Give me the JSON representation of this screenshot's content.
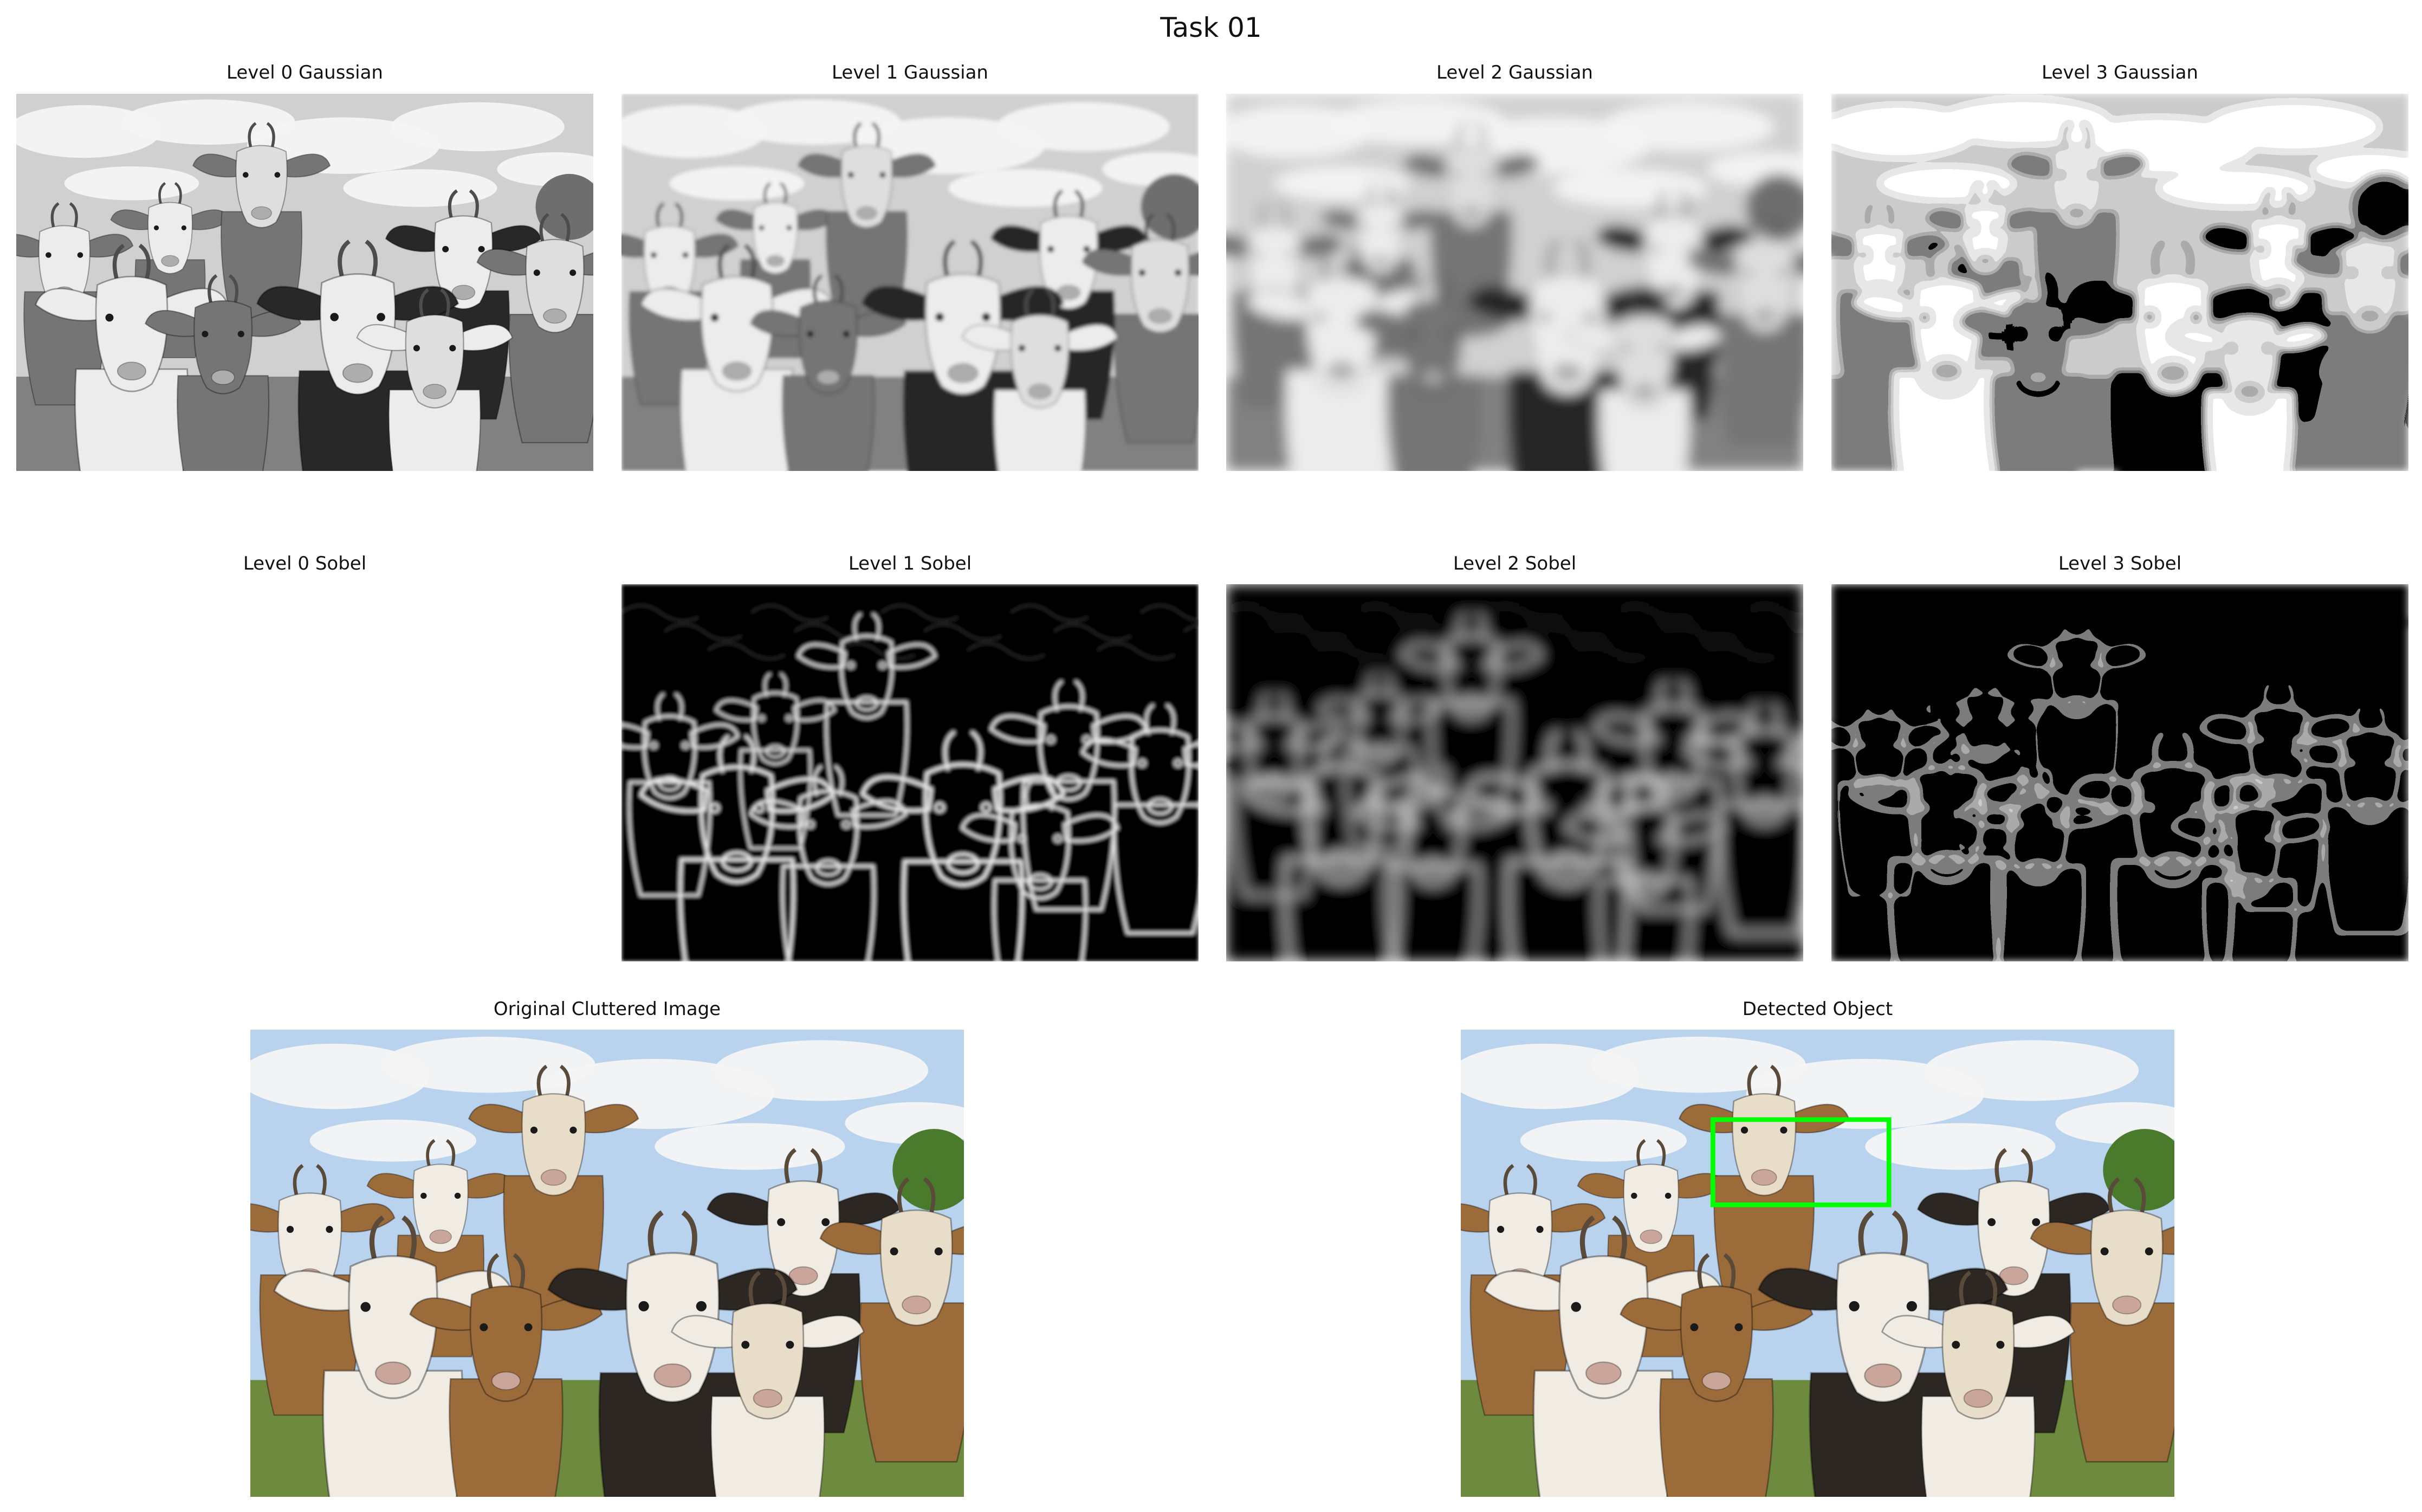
{
  "figure": {
    "title": "Task 01"
  },
  "panels": [
    {
      "key": "g0",
      "title": "Level 0 Gaussian",
      "kind": "gray",
      "blur": 0,
      "pixel": 0
    },
    {
      "key": "g1",
      "title": "Level 1 Gaussian",
      "kind": "gray",
      "blur": 2,
      "pixel": 0
    },
    {
      "key": "g2",
      "title": "Level 2 Gaussian",
      "kind": "gray",
      "blur": 7,
      "pixel": 0
    },
    {
      "key": "g3",
      "title": "Level 3 Gaussian",
      "kind": "gray",
      "blur": 0,
      "pixel": 1
    },
    {
      "key": "s0",
      "title": "Level 0 Sobel",
      "kind": "sobel",
      "blur": 0,
      "pixel": 0
    },
    {
      "key": "s1",
      "title": "Level 1 Sobel",
      "kind": "sobel",
      "blur": 2,
      "pixel": 0
    },
    {
      "key": "s2",
      "title": "Level 2 Sobel",
      "kind": "sobel",
      "blur": 7,
      "pixel": 0
    },
    {
      "key": "s3",
      "title": "Level 3 Sobel",
      "kind": "sobel",
      "blur": 0,
      "pixel": 1
    },
    {
      "key": "orig",
      "title": "Original Cluttered Image",
      "kind": "color",
      "blur": 0,
      "pixel": 0
    },
    {
      "key": "det",
      "title": "Detected Object",
      "kind": "color",
      "blur": 0,
      "pixel": 0
    }
  ],
  "detection": {
    "box_color": "#00ff00"
  },
  "colors": {
    "sky": "#b9d3ef",
    "cloud": "#f5f5f5",
    "grass": "#6d8a3e",
    "tree": "#4a7a2c",
    "goat_white": "#f0ece3",
    "goat_brown": "#9b6b3a",
    "goat_dark": "#2c2722",
    "goat_cream": "#e8ddc8"
  }
}
